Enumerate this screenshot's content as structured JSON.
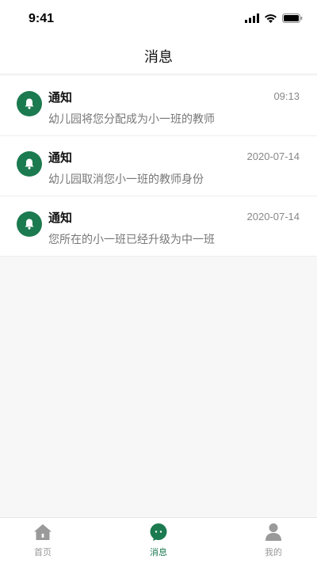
{
  "status_bar": {
    "time": "9:41"
  },
  "header": {
    "title": "消息"
  },
  "messages": [
    {
      "title": "通知",
      "time": "09:13",
      "body": "幼儿园将您分配成为小一班的教师",
      "icon": "bell-icon"
    },
    {
      "title": "通知",
      "time": "2020-07-14",
      "body": "幼儿园取消您小一班的教师身份",
      "icon": "bell-icon"
    },
    {
      "title": "通知",
      "time": "2020-07-14",
      "body": "您所在的小一班已经升级为中一班",
      "icon": "bell-icon"
    }
  ],
  "tab_bar": {
    "items": [
      {
        "label": "首页",
        "icon": "home-icon",
        "active": false
      },
      {
        "label": "消息",
        "icon": "message-icon",
        "active": true
      },
      {
        "label": "我的",
        "icon": "user-icon",
        "active": false
      }
    ]
  },
  "colors": {
    "accent": "#1b7a4f",
    "inactive": "#999999"
  }
}
